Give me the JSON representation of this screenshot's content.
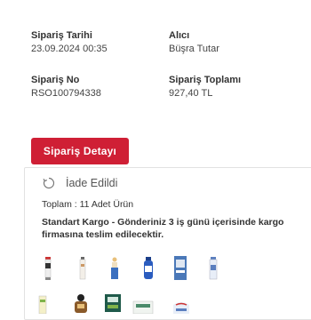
{
  "order": {
    "date_label": "Sipariş Tarihi",
    "date_value": "23.09.2024 00:35",
    "buyer_label": "Alıcı",
    "buyer_value": "Büşra Tutar",
    "number_label": "Sipariş No",
    "number_value": "RSO100794338",
    "total_label": "Sipariş Toplamı",
    "total_value": "927,40 TL"
  },
  "detail_button": {
    "label": "Sipariş Detayı"
  },
  "shipment": {
    "status_icon": "refund-icon",
    "status_text": "İade Edildi",
    "total_items": "Toplam : 11 Adet Ürün",
    "shipping_text": "Standart Kargo - Gönderiniz 3 iş günü içerisinde kargo firmasına teslim edilecektir."
  },
  "colors": {
    "accent": "#cf1f35",
    "text": "#333333",
    "border": "#e2e2e2"
  },
  "products": [
    {
      "name": "product-thumbnail-1"
    },
    {
      "name": "product-thumbnail-2"
    },
    {
      "name": "product-thumbnail-3"
    },
    {
      "name": "product-thumbnail-4"
    },
    {
      "name": "product-thumbnail-5"
    },
    {
      "name": "product-thumbnail-6"
    },
    {
      "name": "product-thumbnail-7"
    },
    {
      "name": "product-thumbnail-8"
    },
    {
      "name": "product-thumbnail-9"
    },
    {
      "name": "product-thumbnail-10"
    },
    {
      "name": "product-thumbnail-11"
    }
  ]
}
